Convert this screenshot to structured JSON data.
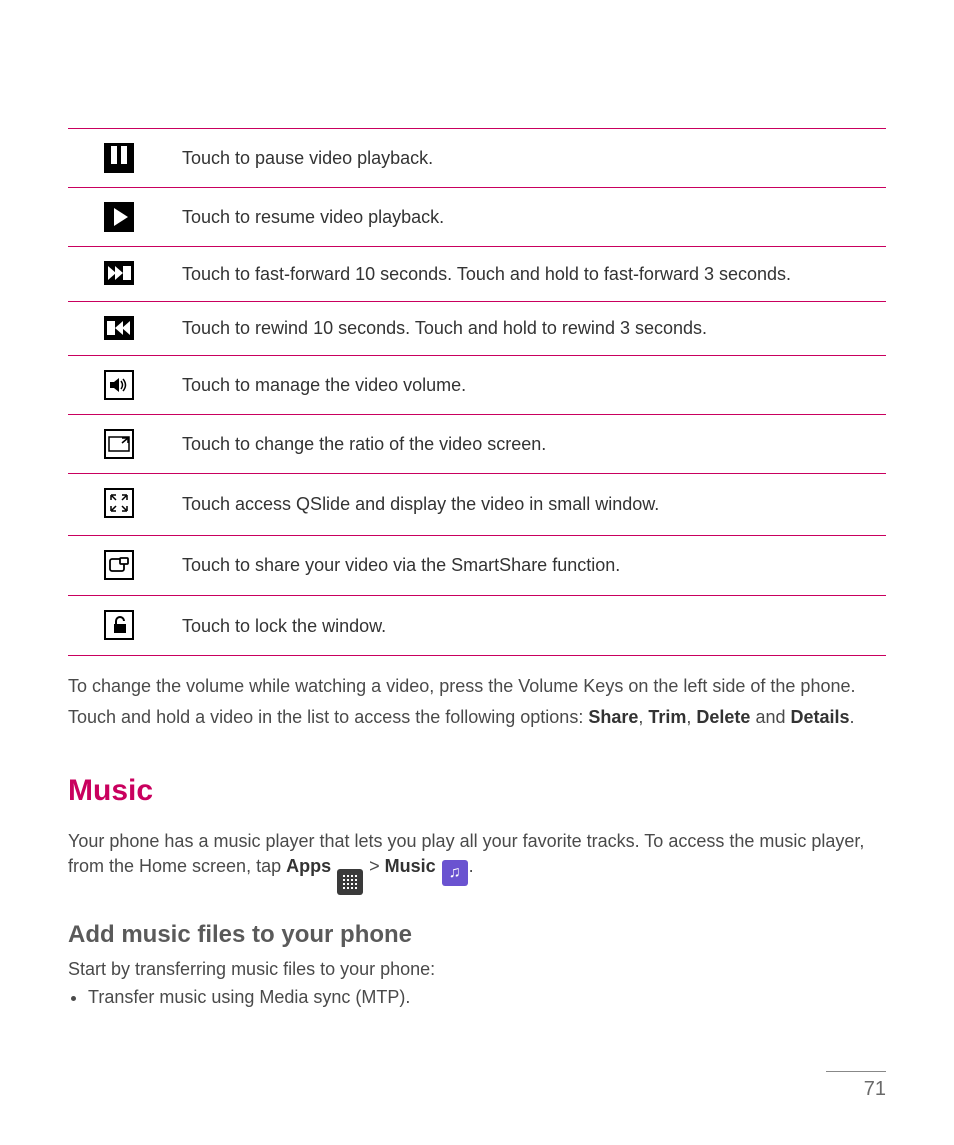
{
  "table": {
    "rows": [
      {
        "icon": "pause-icon",
        "desc": "Touch to pause video playback."
      },
      {
        "icon": "play-icon",
        "desc": "Touch to resume video playback."
      },
      {
        "icon": "fast-forward-icon",
        "desc": "Touch to fast-forward 10 seconds. Touch and hold to fast-forward 3 seconds."
      },
      {
        "icon": "rewind-icon",
        "desc": "Touch to rewind 10 seconds. Touch and hold to rewind 3 seconds."
      },
      {
        "icon": "volume-icon",
        "desc": "Touch to manage the video volume."
      },
      {
        "icon": "screen-ratio-icon",
        "desc": "Touch to change the ratio of the video screen."
      },
      {
        "icon": "qslide-icon",
        "desc": "Touch access QSlide and display the video in small window."
      },
      {
        "icon": "smartshare-icon",
        "desc": "Touch to share your video via the SmartShare function."
      },
      {
        "icon": "lock-icon",
        "desc": "Touch to lock the window."
      }
    ]
  },
  "paragraphs": {
    "volume_note": "To change the volume while watching a video, press the Volume Keys on the left side of the phone.",
    "hold_prefix": "Touch and hold a video in the list to access the following options: ",
    "opts": {
      "share": "Share",
      "trim": "Trim",
      "delete": "Delete",
      "details": "Details"
    },
    "sep_comma": ", ",
    "sep_and": " and ",
    "period": "."
  },
  "music": {
    "heading": "Music",
    "intro_prefix": "Your phone has a music player that lets you play all your favorite tracks. To access the music player, from the Home screen, tap ",
    "apps_label": "Apps",
    "gt": " > ",
    "music_label": "Music",
    "subheading": "Add music files to your phone",
    "start_line": "Start by transferring music files to your phone:",
    "bullets": [
      "Transfer music using Media sync (MTP)."
    ]
  },
  "page_number": "71"
}
